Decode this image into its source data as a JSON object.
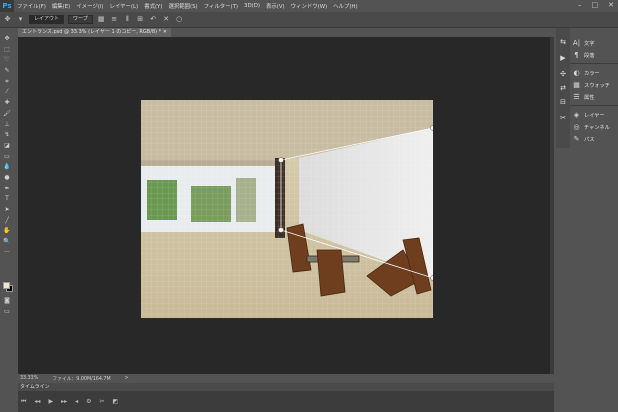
{
  "app": {
    "logo": "Ps"
  },
  "menus": [
    "ファイル(F)",
    "編集(E)",
    "イメージ(I)",
    "レイヤー(L)",
    "書式(Y)",
    "選択範囲(S)",
    "フィルター(T)",
    "3D(D)",
    "表示(V)",
    "ウィンドウ(W)",
    "ヘルプ(H)"
  ],
  "window_controls": {
    "minimize": "–",
    "maximize": "□",
    "close": "✕"
  },
  "options": {
    "layout_label": "レイアウト",
    "warp_label": "ワープ"
  },
  "document": {
    "tab_title": "エントランス.psd @ 33.3% (レイヤー 1 のコピー, RGB/8) *"
  },
  "status": {
    "zoom": "33.33%",
    "file_info": "ファイル：9.00M/164.7M",
    "arrow": ">"
  },
  "timeline": {
    "title": "タイムライン"
  },
  "panels": {
    "character": "文字",
    "paragraph": "段落",
    "color": "カラー",
    "swatches": "スウォッチ",
    "properties": "属性",
    "layers": "レイヤー",
    "channels": "チャンネル",
    "paths": "パス"
  },
  "colors": {
    "accent": "#31a8ff",
    "foreground": "#f1e8c8",
    "background": "#000000"
  }
}
